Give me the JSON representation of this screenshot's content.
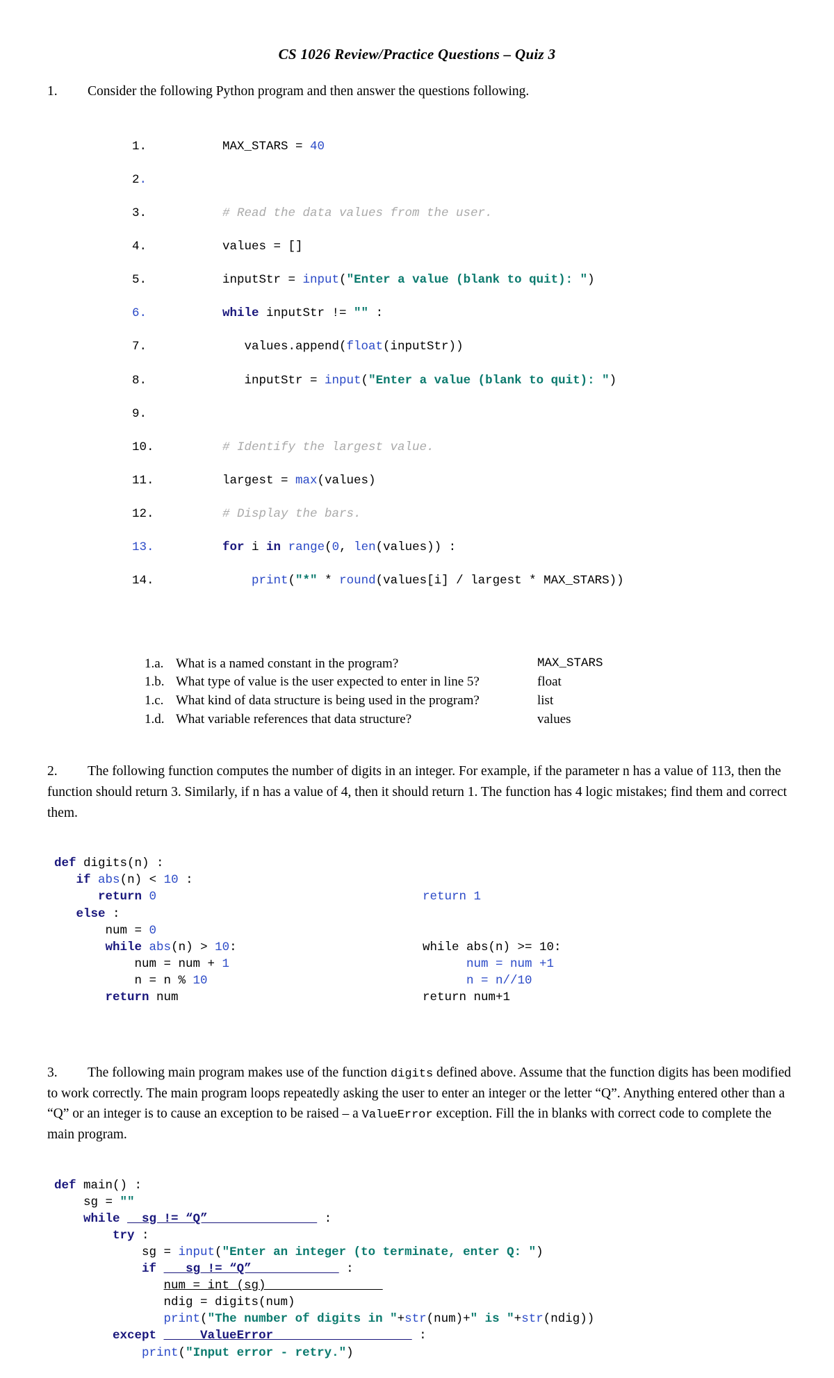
{
  "document": {
    "title": "CS 1026 Review/Practice Questions – Quiz 3"
  },
  "q1": {
    "number": "1.",
    "prompt": "Consider the following Python program and then answer the questions following.",
    "listing": [
      {
        "n": "1.",
        "n_blue": false,
        "code": "MAX_STARS = 40"
      },
      {
        "n": "2.",
        "n_blue": false,
        "code": ""
      },
      {
        "n": "3.",
        "n_blue": false,
        "code": "# Read the data values from the user."
      },
      {
        "n": "4.",
        "n_blue": false,
        "code": "values = []"
      },
      {
        "n": "5.",
        "n_blue": false,
        "code": "inputStr = input(\"Enter a value (blank to quit): \")"
      },
      {
        "n": "6.",
        "n_blue": true,
        "code": "while inputStr != \"\" :"
      },
      {
        "n": "7.",
        "n_blue": false,
        "code": "   values.append(float(inputStr))"
      },
      {
        "n": "8.",
        "n_blue": false,
        "code": "   inputStr = input(\"Enter a value (blank to quit): \")"
      },
      {
        "n": "9.",
        "n_blue": false,
        "code": ""
      },
      {
        "n": "10.",
        "n_blue": false,
        "code": "# Identify the largest value."
      },
      {
        "n": "11.",
        "n_blue": false,
        "code": "largest = max(values)"
      },
      {
        "n": "12.",
        "n_blue": false,
        "code": "# Display the bars."
      },
      {
        "n": "13.",
        "n_blue": true,
        "code": "for i in range(0, len(values)) :"
      },
      {
        "n": "14.",
        "n_blue": false,
        "code": "   print(\"*\" * round(values[i] / largest * MAX_STARS))"
      }
    ],
    "subquestions": [
      {
        "label": "1.a.",
        "text": "What is a named constant in the program?",
        "answer": "MAX_STARS",
        "answer_mono": true
      },
      {
        "label": "1.b.",
        "text": "What type of value is the user expected to enter in line 5?",
        "answer": "float",
        "answer_mono": false
      },
      {
        "label": "1.c.",
        "text": "What kind of data structure is being used in the program?",
        "answer": "list",
        "answer_mono": false
      },
      {
        "label": "1.d.",
        "text": "What variable references that data structure?",
        "answer": "values",
        "answer_mono": false
      }
    ]
  },
  "q2": {
    "number": "2.",
    "prompt_part1": "The following function computes the number of digits in an integer.  For example, if the parameter n has a value of 113, then the function should return 3.  Similarly, if n has a value of 4, then it should return 1.  The function has 4 logic mistakes; find them and correct them.",
    "code_left": [
      "def digits(n) :",
      "   if abs(n) < 10 :",
      "      return 0",
      "   else :",
      "       num = 0",
      "       while abs(n) > 10:",
      "           num = num + 1",
      "           n = n % 10",
      "       return num"
    ],
    "code_right": [
      "return 1",
      "",
      "",
      "while abs(n) >= 10:",
      "     num = num +1",
      "     n = n//10",
      "return num+1"
    ]
  },
  "q3": {
    "number": "3.",
    "prompt": "The following main program makes use of the function digits defined above.  Assume that the function digits has been modified to work correctly.  The main program loops repeatedly asking the user to enter an integer or the letter “Q”.  Anything entered other than a “Q” or an integer is to cause an exception to be raised – a ValueError exception.  Fill the in blanks with correct code to complete the main program.",
    "inline_mono_1": "digits",
    "inline_mono_2": "ValueError",
    "code": [
      "def main() :",
      "    sg = \"\"",
      "    while __sg != “Q”_______________ :",
      "        try :",
      "            sg = input(\"Enter an integer (to terminate, enter Q: \")",
      "            if ___sg != “Q”____________ :",
      "               num = int (sg)________________",
      "               ndig = digits(num)",
      "               print(\"The number of digits in \"+str(num)+\" is \"+str(ndig))",
      "        except ____ ValueError __________________ :",
      "            print(\"Input error - retry.\")"
    ]
  },
  "colors": {
    "keyword": "#19177C",
    "builtin": "#2b4ac7",
    "string": "#0b7a6e",
    "comment": "#aaaaaa",
    "text": "#000000"
  }
}
